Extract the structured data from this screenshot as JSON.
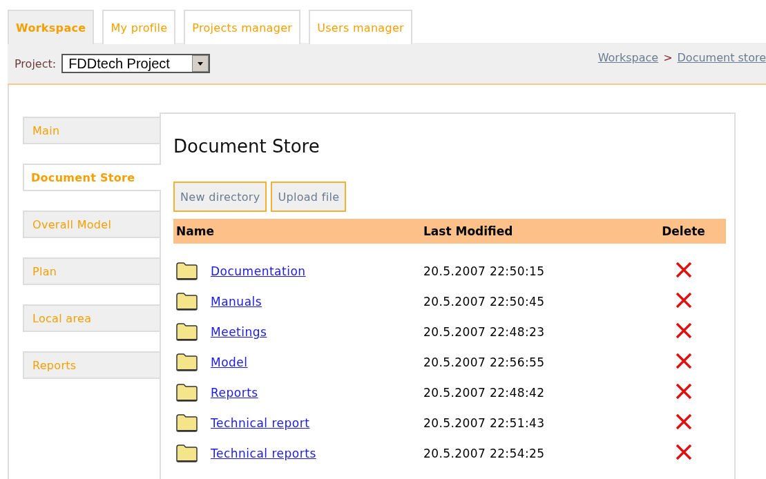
{
  "tabs": [
    {
      "label": "Workspace",
      "selected": true
    },
    {
      "label": "My profile",
      "selected": false
    },
    {
      "label": "Projects manager",
      "selected": false
    },
    {
      "label": "Users manager",
      "selected": false
    }
  ],
  "project_bar": {
    "label": "Project:",
    "project_select": {
      "value": "FDDtech Project"
    },
    "breadcrumb": [
      {
        "label": "Workspace"
      },
      {
        "label": "Document store"
      }
    ],
    "separator": ">"
  },
  "sidebar": {
    "items": [
      {
        "label": "Main",
        "selected": false
      },
      {
        "label": "Document Store",
        "selected": true
      },
      {
        "label": "Overall Model",
        "selected": false
      },
      {
        "label": "Plan",
        "selected": false
      },
      {
        "label": "Local area",
        "selected": false
      },
      {
        "label": "Reports",
        "selected": false
      }
    ]
  },
  "content": {
    "title": "Document Store",
    "buttons": [
      "New directory",
      "Upload file"
    ],
    "table": {
      "columns": [
        "Name",
        "Last Modified",
        "Delete"
      ],
      "rows": [
        {
          "name": "Documentation",
          "modified": "20.5.2007 22:50:15"
        },
        {
          "name": "Manuals",
          "modified": "20.5.2007 22:50:45"
        },
        {
          "name": "Meetings",
          "modified": "20.5.2007 22:48:23"
        },
        {
          "name": "Model",
          "modified": "20.5.2007 22:56:55"
        },
        {
          "name": "Reports",
          "modified": "20.5.2007 22:48:42"
        },
        {
          "name": "Technical report",
          "modified": "20.5.2007 22:51:43"
        },
        {
          "name": "Technical reports",
          "modified": "20.5.2007 22:54:25"
        }
      ]
    }
  }
}
